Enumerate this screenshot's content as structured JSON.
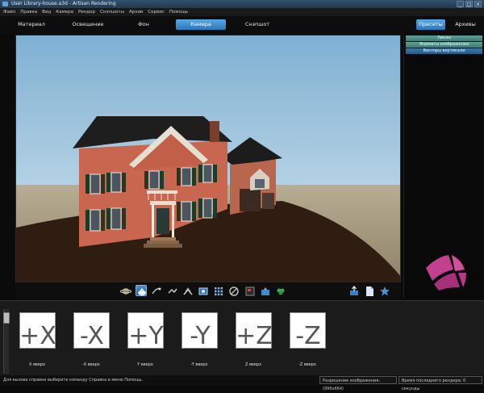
{
  "window": {
    "title": "User Library-house.a3d - Artisan Rendering",
    "buttons": [
      "_",
      "□",
      "×"
    ]
  },
  "menu": [
    "Файл",
    "Правка",
    "Вид",
    "Камера",
    "Рендер",
    "Снэпшоты",
    "Архив",
    "Сервис",
    "Помощь"
  ],
  "tabs": [
    "Материал",
    "Освещение",
    "Фон",
    "Камера",
    "Снэпшот"
  ],
  "active_tab": "Камера",
  "right_tabs": [
    "Пресеты",
    "Архивы"
  ],
  "active_right_tab": "Пресеты",
  "presets": [
    "Линзы",
    "Форматы изображения",
    "Векторы вертикали"
  ],
  "tools": [
    "orbit-icon",
    "camera-view-icon",
    "fly-icon",
    "pan-icon",
    "raise-icon",
    "frame-icon",
    "grid-icon",
    "no-icon",
    "panel-icon",
    "screenshot-icon",
    "plant-icon"
  ],
  "right_tools": [
    "export-icon",
    "document-icon",
    "star-icon"
  ],
  "thumbnails": [
    {
      "glyph": "+X",
      "label": "X вверх"
    },
    {
      "glyph": "-X",
      "label": "-X вверх"
    },
    {
      "glyph": "+Y",
      "label": "Y вверх"
    },
    {
      "glyph": "-Y",
      "label": "-Y вверх"
    },
    {
      "glyph": "+Z",
      "label": "Z вверх"
    },
    {
      "glyph": "-Z",
      "label": "-Z вверх"
    }
  ],
  "status": {
    "hint": "Для вызова справки выберите команду Справка в меню Помощь.",
    "resolution": "Разрешение изображения: (996x664)",
    "last_render": "Время последнего рендера: 0 секунды"
  },
  "colors": {
    "accent": "#3f8fd6",
    "preset_teal": "#4f9188",
    "preset_blue": "#2f6a9c",
    "sky": "#9ec2da",
    "house_brick": "#c96650",
    "logo": "#c2418e"
  }
}
